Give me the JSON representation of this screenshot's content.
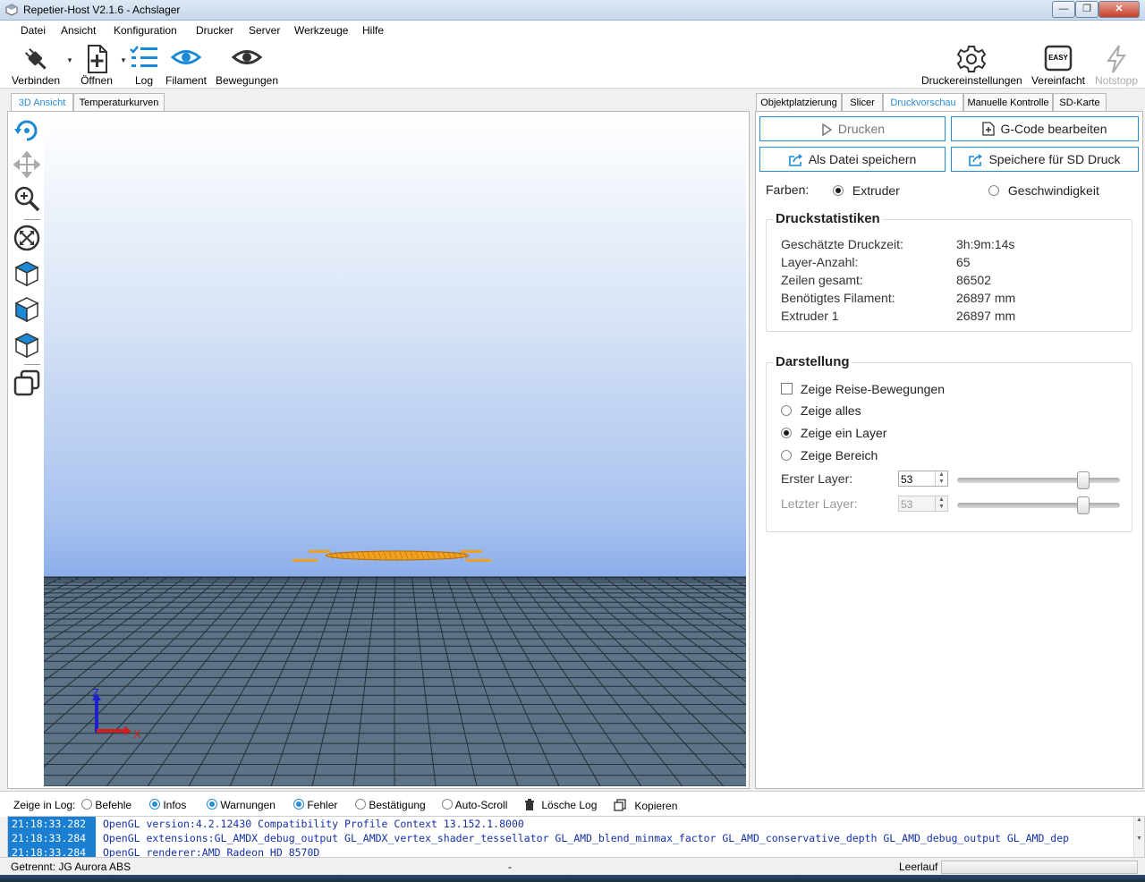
{
  "window": {
    "title": "Repetier-Host V2.1.6 - Achslager"
  },
  "menu": [
    "Datei",
    "Ansicht",
    "Konfiguration",
    "Drucker",
    "Server",
    "Werkzeuge",
    "Hilfe"
  ],
  "toolbar": {
    "connect": "Verbinden",
    "open": "Öffnen",
    "log": "Log",
    "filament": "Filament",
    "moves": "Bewegungen",
    "printer_settings": "Druckereinstellungen",
    "simplified": "Vereinfacht",
    "emergency_stop": "Notstopp",
    "easy_badge": "EASY"
  },
  "left_tabs": [
    "3D Ansicht",
    "Temperaturkurven"
  ],
  "right_tabs": [
    "Objektplatzierung",
    "Slicer",
    "Druckvorschau",
    "Manuelle Kontrolle",
    "SD-Karte"
  ],
  "viewport": {
    "axis_z": "Z",
    "axis_x": "X"
  },
  "preview": {
    "print_button": "Drucken",
    "edit_gcode_button": "G-Code bearbeiten",
    "save_file_button": "Als Datei speichern",
    "save_sd_button": "Speichere für SD Druck",
    "colors_label": "Farben:",
    "color_extruder": "Extruder",
    "color_speed": "Geschwindigkeit"
  },
  "stats": {
    "title": "Druckstatistiken",
    "rows": [
      {
        "label": "Geschätzte Druckzeit:",
        "value": "3h:9m:14s"
      },
      {
        "label": "Layer-Anzahl:",
        "value": "65"
      },
      {
        "label": "Zeilen gesamt:",
        "value": "86502"
      },
      {
        "label": "Benötigtes Filament:",
        "value": "26897 mm"
      },
      {
        "label": "Extruder 1",
        "value": "26897 mm"
      }
    ]
  },
  "display": {
    "title": "Darstellung",
    "show_travel": "Zeige Reise-Bewegungen",
    "show_all": "Zeige alles",
    "show_one_layer": "Zeige ein Layer",
    "show_range": "Zeige Bereich",
    "first_layer_label": "Erster Layer:",
    "first_layer_value": "53",
    "last_layer_label": "Letzter Layer:",
    "last_layer_value": "53",
    "first_layer_fraction": 0.8,
    "last_layer_fraction": 0.8
  },
  "log": {
    "show_label": "Zeige in Log:",
    "commands": "Befehle",
    "infos": "Infos",
    "warnings": "Warnungen",
    "errors": "Fehler",
    "ack": "Bestätigung",
    "autoscroll": "Auto-Scroll",
    "clear": "Lösche Log",
    "copy": "Kopieren",
    "lines": [
      {
        "time": "21:18:33.282",
        "text": "OpenGL version:4.2.12430 Compatibility Profile Context 13.152.1.8000"
      },
      {
        "time": "21:18:33.284",
        "text": "OpenGL extensions:GL_AMDX_debug_output GL_AMDX_vertex_shader_tessellator GL_AMD_blend_minmax_factor GL_AMD_conservative_depth GL_AMD_debug_output GL_AMD_dep"
      },
      {
        "time": "21:18:33.284",
        "text": "OpenGL renderer:AMD Radeon HD 8570D"
      }
    ]
  },
  "status": {
    "connection": "Getrennt: JG Aurora ABS",
    "middle": "-",
    "idle": "Leerlauf"
  }
}
